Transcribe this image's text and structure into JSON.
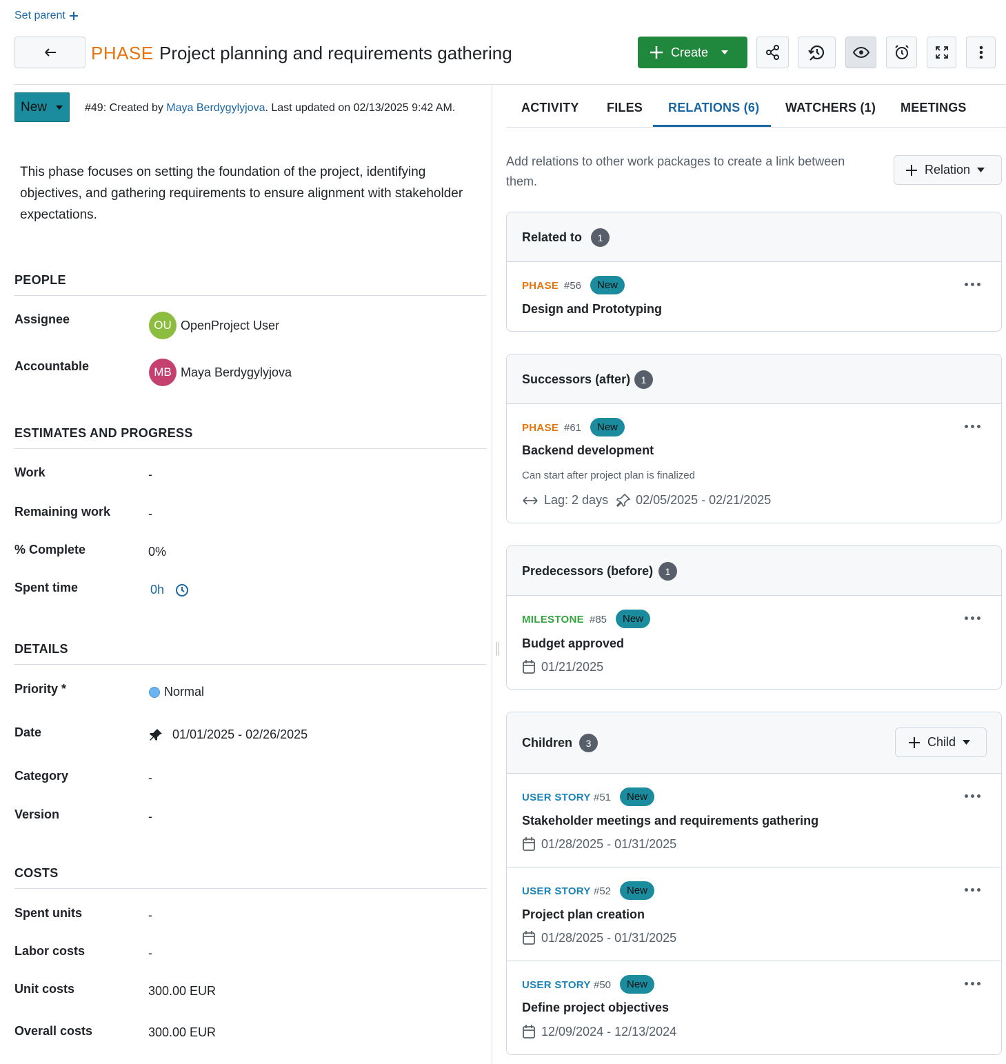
{
  "header": {
    "set_parent": "Set parent",
    "type": "PHASE",
    "title": "Project planning and requirements gathering",
    "create_label": "Create"
  },
  "status": {
    "label": "New",
    "meta_prefix": "#49: Created by ",
    "author": "Maya Berdygylyjova",
    "meta_suffix": ". Last updated on 02/13/2025 9:42 AM."
  },
  "description": "This phase focuses on setting the foundation of the project, identifying objectives, and gathering requirements to ensure alignment with stakeholder expectations.",
  "people": {
    "heading": "PEOPLE",
    "assignee_label": "Assignee",
    "assignee_initials": "OU",
    "assignee_name": "OpenProject User",
    "assignee_color": "#8cbd3e",
    "accountable_label": "Accountable",
    "accountable_initials": "MB",
    "accountable_name": "Maya Berdygylyjova",
    "accountable_color": "#c4406f"
  },
  "estimates": {
    "heading": "ESTIMATES AND PROGRESS",
    "work_label": "Work",
    "work_value": "-",
    "remaining_label": "Remaining work",
    "remaining_value": "-",
    "complete_label": "% Complete",
    "complete_value": "0%",
    "spent_label": "Spent time",
    "spent_value": "0h"
  },
  "details": {
    "heading": "DETAILS",
    "priority_label": "Priority *",
    "priority_value": "Normal",
    "priority_color": "#6cb4f0",
    "date_label": "Date",
    "date_value": "01/01/2025 - 02/26/2025",
    "category_label": "Category",
    "category_value": "-",
    "version_label": "Version",
    "version_value": "-"
  },
  "costs": {
    "heading": "COSTS",
    "spent_units_label": "Spent units",
    "spent_units_value": "-",
    "labor_label": "Labor costs",
    "labor_value": "-",
    "unit_label": "Unit costs",
    "unit_value": "300.00 EUR",
    "overall_label": "Overall costs",
    "overall_value": "300.00 EUR"
  },
  "tabs": [
    "ACTIVITY",
    "FILES",
    "RELATIONS (6)",
    "WATCHERS (1)",
    "MEETINGS"
  ],
  "relations": {
    "hint": "Add relations to other work packages to create a link between them.",
    "relation_btn": "Relation",
    "related_to": {
      "title": "Related to",
      "count": "1",
      "items": [
        {
          "type": "PHASE",
          "num": "#56",
          "status": "New",
          "title": "Design and Prototyping"
        }
      ]
    },
    "successors": {
      "title": "Successors (after)",
      "count": "1",
      "items": [
        {
          "type": "PHASE",
          "num": "#61",
          "status": "New",
          "title": "Backend development",
          "note": "Can start after project plan is finalized",
          "lag": "Lag: 2 days",
          "dates": "02/05/2025 - 02/21/2025"
        }
      ]
    },
    "predecessors": {
      "title": "Predecessors (before)",
      "count": "1",
      "items": [
        {
          "type": "MILESTONE",
          "num": "#85",
          "status": "New",
          "title": "Budget approved",
          "dates": "01/21/2025"
        }
      ]
    },
    "children": {
      "title": "Children",
      "count": "3",
      "child_btn": "Child",
      "items": [
        {
          "type": "USER STORY",
          "num": "#51",
          "status": "New",
          "title": "Stakeholder meetings and requirements gathering",
          "dates": "01/28/2025 - 01/31/2025"
        },
        {
          "type": "USER STORY",
          "num": "#52",
          "status": "New",
          "title": "Project plan creation",
          "dates": "01/28/2025 - 01/31/2025"
        },
        {
          "type": "USER STORY",
          "num": "#50",
          "status": "New",
          "title": "Define project objectives",
          "dates": "12/09/2024 - 12/13/2024"
        }
      ]
    }
  }
}
